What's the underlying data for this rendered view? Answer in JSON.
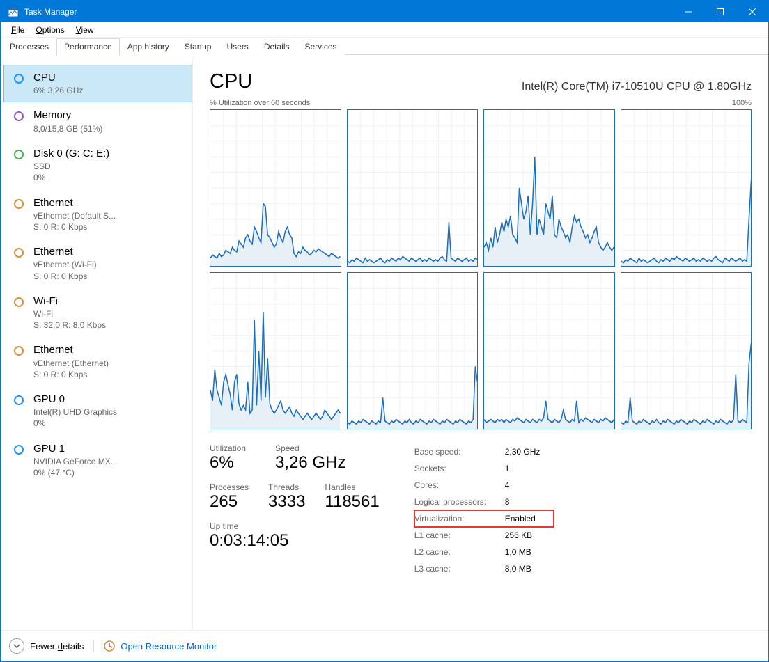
{
  "window": {
    "title": "Task Manager"
  },
  "menu": {
    "File": "File",
    "Options": "Options",
    "View": "View"
  },
  "tabs": [
    "Processes",
    "Performance",
    "App history",
    "Startup",
    "Users",
    "Details",
    "Services"
  ],
  "active_tab": 1,
  "sidebar": [
    {
      "icon": "blue",
      "title": "CPU",
      "subs": [
        "6%  3,26 GHz"
      ]
    },
    {
      "icon": "purple",
      "title": "Memory",
      "subs": [
        "8,0/15,8 GB (51%)"
      ]
    },
    {
      "icon": "green",
      "title": "Disk 0 (G: C: E:)",
      "subs": [
        "SSD",
        "0%"
      ]
    },
    {
      "icon": "orange",
      "title": "Ethernet",
      "subs": [
        "vEthernet (Default S...",
        "S: 0  R: 0 Kbps"
      ]
    },
    {
      "icon": "orange",
      "title": "Ethernet",
      "subs": [
        "vEthernet (Wi-Fi)",
        "S: 0  R: 0 Kbps"
      ]
    },
    {
      "icon": "orange",
      "title": "Wi-Fi",
      "subs": [
        "Wi-Fi",
        "S: 32,0  R: 8,0 Kbps"
      ]
    },
    {
      "icon": "orange",
      "title": "Ethernet",
      "subs": [
        "vEthernet (Ethernet)",
        "S: 0  R: 0 Kbps"
      ]
    },
    {
      "icon": "blue",
      "title": "GPU 0",
      "subs": [
        "Intel(R) UHD Graphics",
        "0%"
      ]
    },
    {
      "icon": "blue",
      "title": "GPU 1",
      "subs": [
        "NVIDIA GeForce MX...",
        "0% (47 °C)"
      ]
    }
  ],
  "selected_sidebar": 0,
  "header": {
    "title": "CPU",
    "model": "Intel(R) Core(TM) i7-10510U CPU @ 1.80GHz"
  },
  "chart_label": {
    "left": "% Utilization over 60 seconds",
    "right": "100%"
  },
  "stats": {
    "utilization": {
      "label": "Utilization",
      "value": "6%"
    },
    "speed": {
      "label": "Speed",
      "value": "3,26 GHz"
    },
    "processes": {
      "label": "Processes",
      "value": "265"
    },
    "threads": {
      "label": "Threads",
      "value": "3333"
    },
    "handles": {
      "label": "Handles",
      "value": "118561"
    },
    "uptime": {
      "label": "Up time",
      "value": "0:03:14:05"
    }
  },
  "specs": [
    {
      "k": "Base speed:",
      "v": "2,30 GHz"
    },
    {
      "k": "Sockets:",
      "v": "1"
    },
    {
      "k": "Cores:",
      "v": "4"
    },
    {
      "k": "Logical processors:",
      "v": "8"
    },
    {
      "k": "Virtualization:",
      "v": "Enabled",
      "hl": true
    },
    {
      "k": "L1 cache:",
      "v": "256 KB"
    },
    {
      "k": "L2 cache:",
      "v": "1,0 MB"
    },
    {
      "k": "L3 cache:",
      "v": "8,0 MB"
    }
  ],
  "footer": {
    "fewer": "Fewer details",
    "monitor": "Open Resource Monitor"
  },
  "chart_data": {
    "type": "line",
    "note": "8 sparkline panes of per-core CPU % over 60s, 0..100, values estimated from pixels",
    "panes": [
      [
        5,
        7,
        6,
        5,
        8,
        6,
        7,
        10,
        9,
        8,
        12,
        10,
        9,
        16,
        14,
        12,
        18,
        20,
        16,
        14,
        25,
        22,
        18,
        15,
        40,
        38,
        20,
        18,
        15,
        12,
        14,
        22,
        18,
        15,
        22,
        25,
        20,
        18,
        8,
        6,
        9,
        8,
        12,
        10,
        9,
        7,
        8,
        10,
        9,
        11,
        10,
        9,
        8,
        7,
        6,
        8,
        7,
        6,
        5,
        6
      ],
      [
        3,
        2,
        4,
        3,
        5,
        4,
        3,
        2,
        5,
        3,
        4,
        3,
        2,
        3,
        4,
        5,
        3,
        2,
        4,
        3,
        5,
        4,
        3,
        5,
        4,
        6,
        5,
        4,
        3,
        5,
        4,
        3,
        4,
        5,
        3,
        4,
        3,
        5,
        4,
        3,
        4,
        3,
        5,
        6,
        4,
        3,
        28,
        5,
        4,
        3,
        5,
        4,
        3,
        4,
        5,
        3,
        4,
        3,
        5,
        4
      ],
      [
        12,
        15,
        10,
        18,
        12,
        25,
        15,
        20,
        28,
        22,
        30,
        25,
        32,
        20,
        18,
        15,
        50,
        40,
        30,
        35,
        45,
        20,
        40,
        70,
        20,
        30,
        25,
        20,
        40,
        35,
        30,
        45,
        20,
        18,
        30,
        25,
        22,
        18,
        20,
        15,
        25,
        32,
        28,
        30,
        25,
        22,
        18,
        20,
        15,
        18,
        22,
        25,
        15,
        12,
        10,
        12,
        15,
        12,
        10,
        12
      ],
      [
        3,
        2,
        4,
        3,
        5,
        4,
        3,
        2,
        5,
        3,
        4,
        3,
        2,
        3,
        4,
        5,
        3,
        2,
        4,
        3,
        5,
        4,
        3,
        5,
        4,
        6,
        5,
        4,
        3,
        5,
        4,
        3,
        4,
        5,
        3,
        4,
        3,
        5,
        4,
        3,
        4,
        3,
        5,
        6,
        4,
        3,
        2,
        5,
        4,
        3,
        5,
        4,
        3,
        4,
        5,
        3,
        4,
        3,
        30,
        55
      ],
      [
        25,
        18,
        38,
        25,
        20,
        15,
        30,
        35,
        28,
        22,
        12,
        30,
        35,
        16,
        12,
        15,
        12,
        30,
        10,
        12,
        70,
        15,
        50,
        18,
        75,
        20,
        45,
        16,
        12,
        10,
        12,
        15,
        18,
        12,
        10,
        12,
        14,
        10,
        8,
        12,
        10,
        8,
        6,
        8,
        10,
        8,
        6,
        8,
        10,
        8,
        6,
        8,
        12,
        10,
        8,
        6,
        8,
        10,
        12,
        10
      ],
      [
        4,
        3,
        5,
        4,
        3,
        5,
        4,
        6,
        5,
        4,
        3,
        5,
        4,
        3,
        5,
        4,
        20,
        5,
        4,
        3,
        5,
        4,
        6,
        5,
        4,
        3,
        5,
        4,
        6,
        4,
        3,
        5,
        4,
        6,
        5,
        4,
        3,
        5,
        4,
        6,
        5,
        4,
        3,
        5,
        4,
        6,
        5,
        4,
        3,
        5,
        4,
        6,
        5,
        4,
        3,
        5,
        4,
        6,
        40,
        30
      ],
      [
        6,
        4,
        5,
        6,
        5,
        4,
        6,
        5,
        6,
        4,
        6,
        5,
        4,
        6,
        5,
        7,
        6,
        5,
        4,
        6,
        5,
        4,
        6,
        5,
        4,
        6,
        5,
        7,
        18,
        6,
        5,
        4,
        6,
        5,
        4,
        6,
        12,
        6,
        5,
        4,
        6,
        5,
        18,
        4,
        6,
        5,
        7,
        6,
        5,
        4,
        6,
        5,
        4,
        6,
        5,
        7,
        6,
        5,
        4,
        6
      ],
      [
        4,
        3,
        5,
        4,
        20,
        5,
        4,
        3,
        5,
        4,
        6,
        5,
        4,
        3,
        5,
        4,
        6,
        4,
        3,
        5,
        4,
        6,
        5,
        4,
        3,
        5,
        4,
        6,
        5,
        4,
        3,
        5,
        4,
        6,
        5,
        4,
        3,
        5,
        4,
        6,
        5,
        4,
        3,
        5,
        4,
        6,
        5,
        4,
        3,
        5,
        4,
        6,
        35,
        5,
        4,
        6,
        5,
        4,
        42,
        55
      ]
    ],
    "ylim": [
      0,
      100
    ],
    "x_seconds": 60
  }
}
